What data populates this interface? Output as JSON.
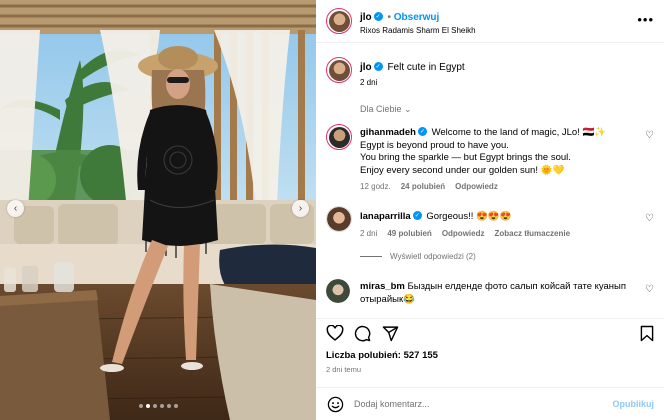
{
  "post": {
    "username": "jlo",
    "follow_label": "Obserwuj",
    "location": "Rixos Radamis Sharm El Sheikh",
    "more_icon": "more-horizontal-icon"
  },
  "caption": {
    "username": "jlo",
    "text": "Felt cute in Egypt",
    "time": "2 dni"
  },
  "filter_label": "Dla Ciebie",
  "comments": [
    {
      "username": "gihanmadeh",
      "lines": [
        "Welcome to the land of magic, JLo! 🇪🇬✨",
        "Egypt is beyond proud to have you.",
        "You bring the sparkle — but Egypt brings the soul.",
        "Enjoy every second under our golden sun! 🌞💛"
      ],
      "time": "12 godz.",
      "likes": "24 polubień",
      "reply_label": "Odpowiedz"
    },
    {
      "username": "lanaparrilla",
      "text": "Gorgeous!! 😍😍😍",
      "time": "2 dni",
      "likes": "49 polubień",
      "reply_label": "Odpowiedz",
      "translate_label": "Zobacz tłumaczenie"
    },
    {
      "username": "miras_bm",
      "lines": [
        "Быздын елденде фото салып койсай тате куанып",
        "отырайык😂"
      ]
    }
  ],
  "view_replies_label": "Wyświetl odpowiedzi (2)",
  "likes_text": "Liczba polubień: 527 155",
  "posted_ago": "2 dni temu",
  "comment_placeholder": "Dodaj komentarz...",
  "publish_label": "Opublikuj",
  "colors": {
    "link_blue": "#0095f6",
    "secondary_text": "#737373",
    "divider": "#efefef"
  }
}
